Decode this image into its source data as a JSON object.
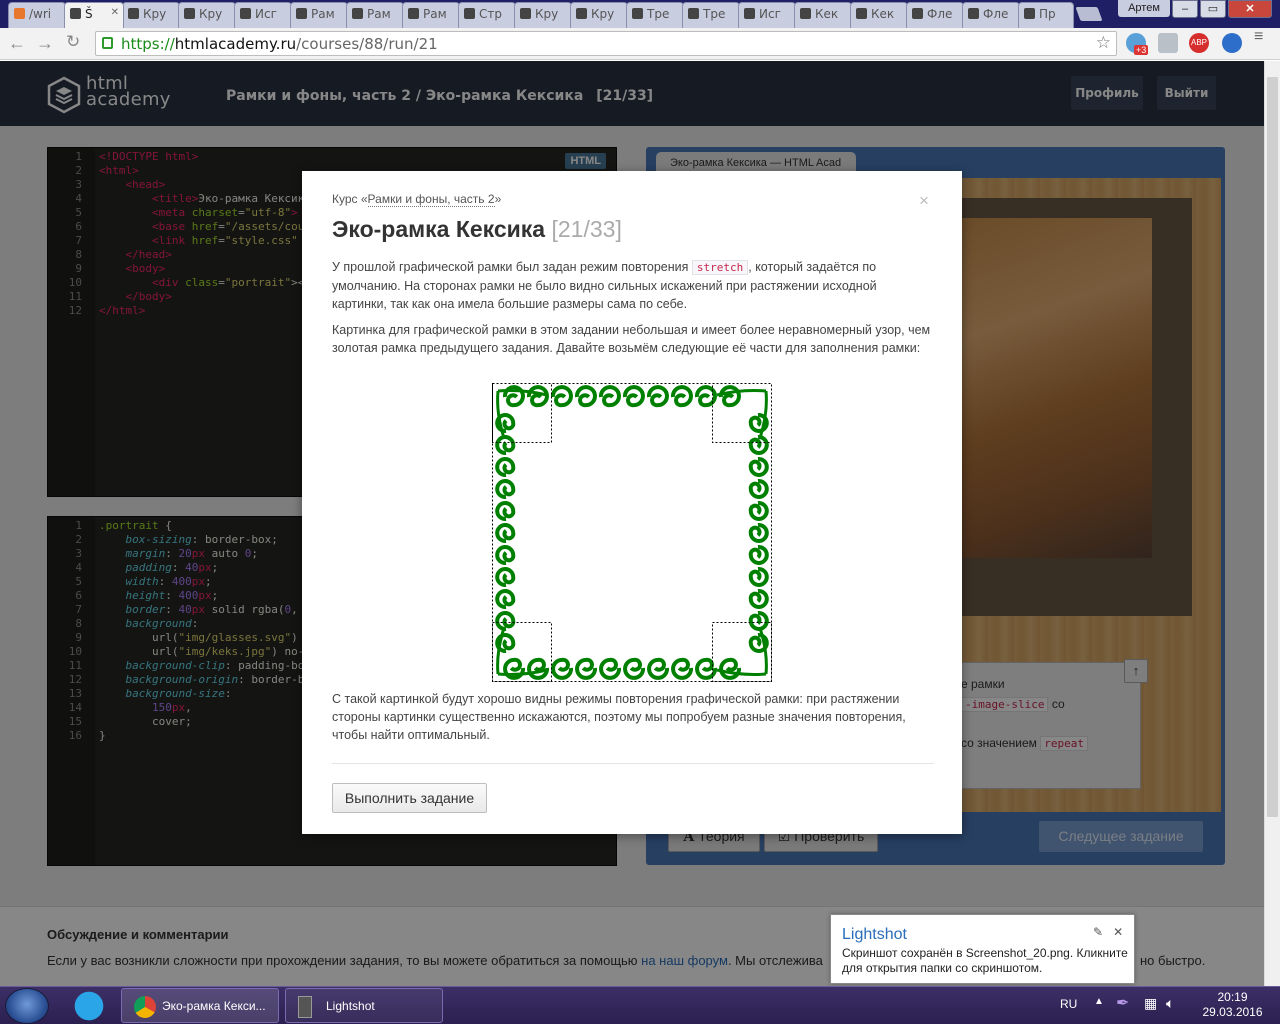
{
  "browser": {
    "tabs": [
      {
        "label": "/wri"
      },
      {
        "label": "Š"
      },
      {
        "label": "Кру"
      },
      {
        "label": "Кру"
      },
      {
        "label": "Исг"
      },
      {
        "label": "Рам"
      },
      {
        "label": "Рам"
      },
      {
        "label": "Рам"
      },
      {
        "label": "Стр"
      },
      {
        "label": "Кру"
      },
      {
        "label": "Кру"
      },
      {
        "label": "Тре"
      },
      {
        "label": "Тре"
      },
      {
        "label": "Исг"
      },
      {
        "label": "Кек"
      },
      {
        "label": "Кек"
      },
      {
        "label": "Фле"
      },
      {
        "label": "Фле"
      },
      {
        "label": "Пр"
      }
    ],
    "user": "Артем",
    "url_scheme": "https://",
    "url_host": "htmlacademy.ru",
    "url_path": "/courses/88/run/21",
    "ext_badge": "+3",
    "abp": "ABP"
  },
  "header": {
    "logo_line1": "html",
    "logo_line2": "academy",
    "breadcrumb_course": "Рамки и фоны, часть 2",
    "breadcrumb_sep": "/",
    "breadcrumb_task": "Эко-рамка Кексика",
    "breadcrumb_count": "[21/33]",
    "profile_button": "Профиль",
    "logout_button": "Выйти"
  },
  "editor_html": {
    "badge": "HTML",
    "line_numbers": "1\n2\n3\n4\n5\n6\n7\n8\n9\n10\n11\n12"
  },
  "editor_css": {
    "line_numbers": "1\n2\n3\n4\n5\n6\n7\n8\n9\n10\n11\n12\n13\n14\n15\n16"
  },
  "preview": {
    "tab_title": "Эко-рамка Кексика — HTML Acad",
    "task_text1": "е рамки",
    "task_code1": "-image-slice",
    "task_text2": "со",
    "task_text3": "со значением",
    "task_code2": "repeat",
    "up_arrow": "↑",
    "theory_button": "Теория",
    "check_button": "Проверить",
    "next_button": "Следущее задание"
  },
  "modal": {
    "course_prefix": "Курс «",
    "course_link": "Рамки и фоны, часть 2",
    "course_suffix": "»",
    "close": "×",
    "title": "Эко-рамка Кексика",
    "title_count": "[21/33]",
    "p1_before": "У прошлой графической рамки был задан режим повторения ",
    "p1_code": "stretch",
    "p1_after": ", который задаётся по умолчанию. На сторонах рамки не было видно сильных искажений при растяжении исходной картинки, так как она имела большие размеры сама по себе.",
    "p2": "Картинка для графической рамки в этом задании небольшая и имеет более неравномерный узор, чем золотая рамка предыдущего задания. Давайте возьмём следующие её части для заполнения рамки:",
    "p3": "С такой картинкой будут хорошо видны режимы повторения графической рамки: при растяжении стороны картинки существенно искажаются, поэтому мы попробуем разные значения повторения, чтобы найти оптимальный.",
    "action_button": "Выполнить задание"
  },
  "discussion": {
    "title": "Обсуждение и комментарии",
    "text_before": "Если у вас возникли сложности при прохождении задания, то вы можете обратиться за помощью ",
    "link": "на наш форум",
    "text_after": ". Мы отслежива",
    "text_end": "но быстро."
  },
  "lightshot": {
    "title": "Lightshot",
    "message": "Скриншот сохранён в Screenshot_20.png. Кликните для открытия папки со скриншотом."
  },
  "taskbar": {
    "task1": "Эко-рамка Кекси...",
    "task2": "Lightshot",
    "lang": "RU",
    "time": "20:19",
    "date": "29.03.2016"
  },
  "colors": {
    "header_bg": "#283142",
    "preview_blue": "#4a78b8",
    "frame_green": "#008000",
    "link_blue": "#2a6db9"
  }
}
